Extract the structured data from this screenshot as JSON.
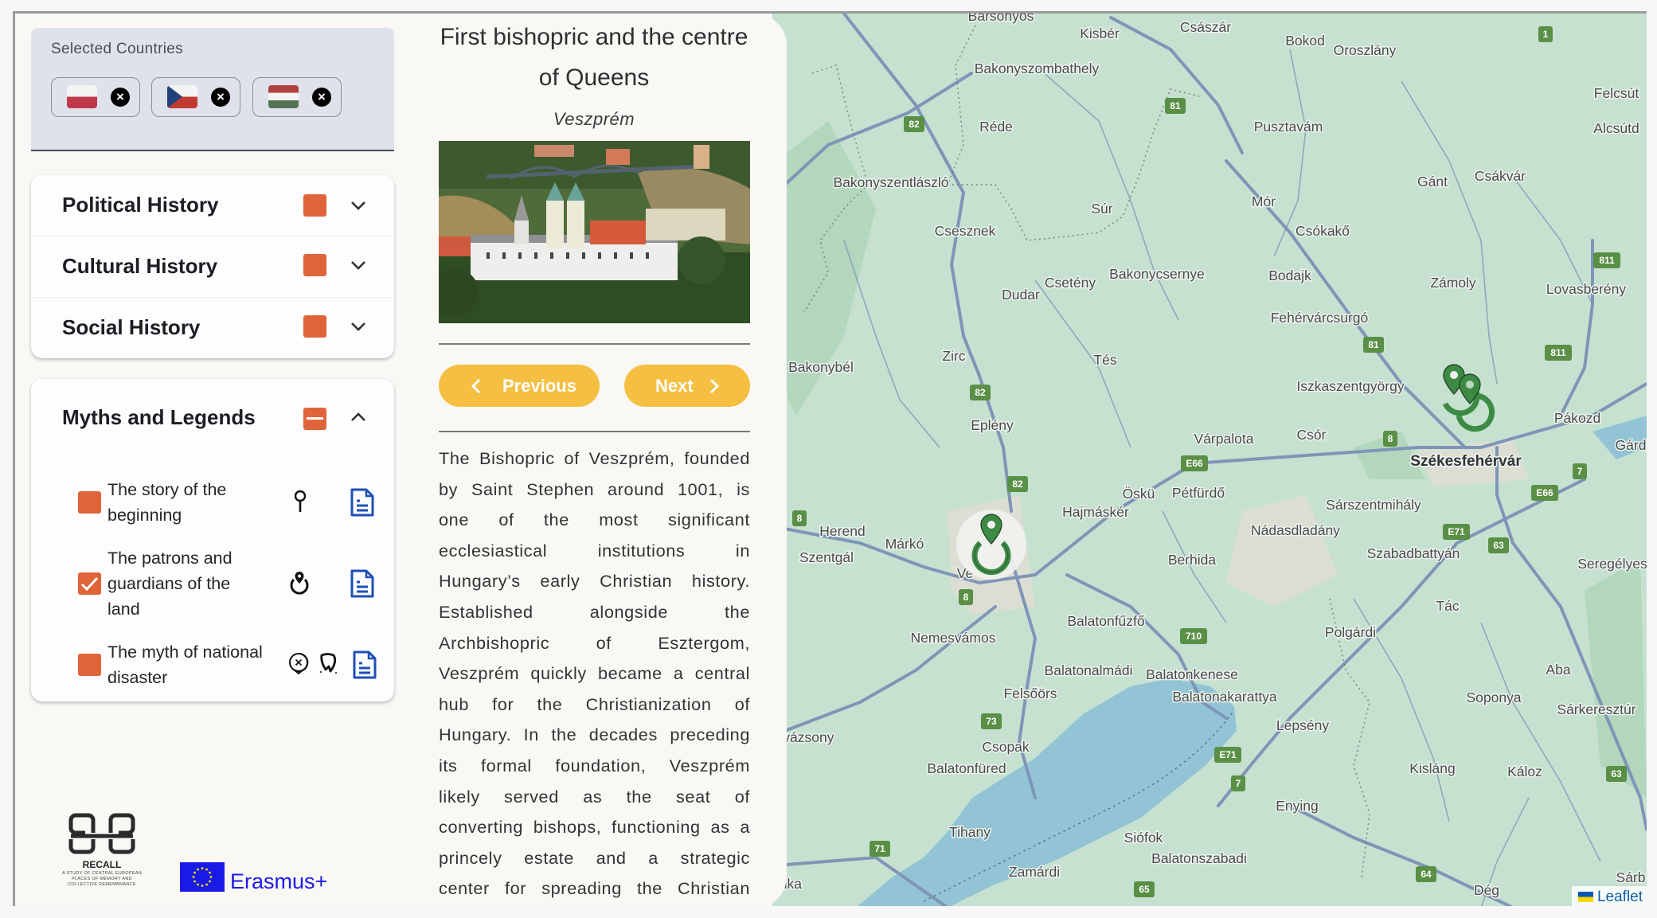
{
  "selected_countries": {
    "label": "Selected Countries",
    "chips": [
      {
        "country": "Poland",
        "remove_icon": "close-circle-icon"
      },
      {
        "country": "Czech Republic",
        "remove_icon": "close-circle-icon"
      },
      {
        "country": "Hungary",
        "remove_icon": "close-circle-icon"
      }
    ]
  },
  "categories": [
    {
      "label": "Political History",
      "state": "collapsed"
    },
    {
      "label": "Cultural History",
      "state": "collapsed"
    },
    {
      "label": "Social History",
      "state": "collapsed"
    }
  ],
  "myths": {
    "label": "Myths and Legends",
    "state": "expanded",
    "checkbox": "indeterminate",
    "items": [
      {
        "label": "The story of the beginning",
        "checked": false,
        "icons": [
          "pin-icon"
        ],
        "doc_icon": "document-icon"
      },
      {
        "label": "The patrons and guardians of the land",
        "checked": true,
        "icons": [
          "map-pin-circle-icon"
        ],
        "doc_icon": "document-icon"
      },
      {
        "label": "The myth of national disaster",
        "checked": false,
        "icons": [
          "cross-circle-icon",
          "broken-shield-icon"
        ],
        "doc_icon": "document-icon"
      }
    ]
  },
  "logos": {
    "recall": "RECALL",
    "recall_sub": "A STUDY OF CENTRAL EUROPEAN PLACES OF MEMORY AND COLLECTIVE REMEMBRANCE",
    "erasmus": "Erasmus+"
  },
  "detail": {
    "title": "First bishopric and the centre of Queens",
    "place": "Veszprém",
    "previous_label": "Previous",
    "next_label": "Next",
    "description_lines": [
      "The Bishopric of Veszprém, founded",
      "by Saint Stephen around 1001, is",
      "one of the most significant",
      "ecclesiastical institutions in",
      "Hungary’s early Christian history.",
      "Established alongside the",
      "Archbishopric of Esztergom,",
      "Veszprém quickly became a central",
      "hub for the Christianization of",
      "Hungary. In the decades preceding",
      "its formal foundation, Veszprém",
      "likely served as the seat of",
      "converting bishops, functioning as a",
      "princely estate and a strategic",
      "center for spreading the Christian"
    ]
  },
  "map": {
    "attribution": "Leaflet",
    "marker_color": "#3d8a45",
    "labels": [
      "Barsonyos",
      "Kisbér",
      "Császár",
      "Bokod",
      "Oroszlány",
      "Felcsút",
      "Alcsútd",
      "Bakonyszombathely",
      "Réde",
      "Pusztavám",
      "Bakonyszentlászló",
      "Gánt",
      "Csákvár",
      "Mór",
      "Súr",
      "Csesznek",
      "Csókakő",
      "Bakonycsernye",
      "Csetény",
      "Dudar",
      "Bodajk",
      "Zámoly",
      "Lovasberény",
      "Fehérvárcsurgó",
      "Zirc",
      "Tés",
      "Bakonybél",
      "Iszkaszentgyörgy",
      "Eplény",
      "Várpalota",
      "Csór",
      "Pákozd",
      "Gárd",
      "Öskü",
      "Pétfürdő",
      "Hajmáskér",
      "Sárszentmihály",
      "Herend",
      "Márkó",
      "Nádasdladány",
      "Berhida",
      "Szentgál",
      "Szabadbattyán",
      "Seregélyes",
      "Tác",
      "Balatonfűzfő",
      "Polgárdi",
      "Nemesvámos",
      "Aba",
      "Balatonalmádi",
      "Balatonkenese",
      "Felsőörs",
      "Balatonakarattya",
      "Soponya",
      "Sárkeresztúr",
      "Lepsény",
      "yvázsony",
      "Csopak",
      "Balatonfüred",
      "Kisláng",
      "Káloz",
      "Enying",
      "Tihany",
      "Siófok",
      "Balatonszabadi",
      "Zamárdi",
      "Dég",
      "ánka",
      "Sárb",
      "Ve"
    ],
    "major_label": "Székesfehérvár",
    "road_shields": [
      "82",
      "81",
      "1",
      "82",
      "82",
      "81",
      "811",
      "811",
      "8",
      "E66",
      "7",
      "E66",
      "E71",
      "63",
      "8",
      "8",
      "710",
      "73",
      "E71",
      "7",
      "71",
      "65",
      "64",
      "63"
    ]
  },
  "colors": {
    "accent": "#e0643a",
    "button": "#f5bf42",
    "doc_icon": "#1f4fb5",
    "map_land": "#c6e1d0",
    "water": "#92c4d6"
  }
}
